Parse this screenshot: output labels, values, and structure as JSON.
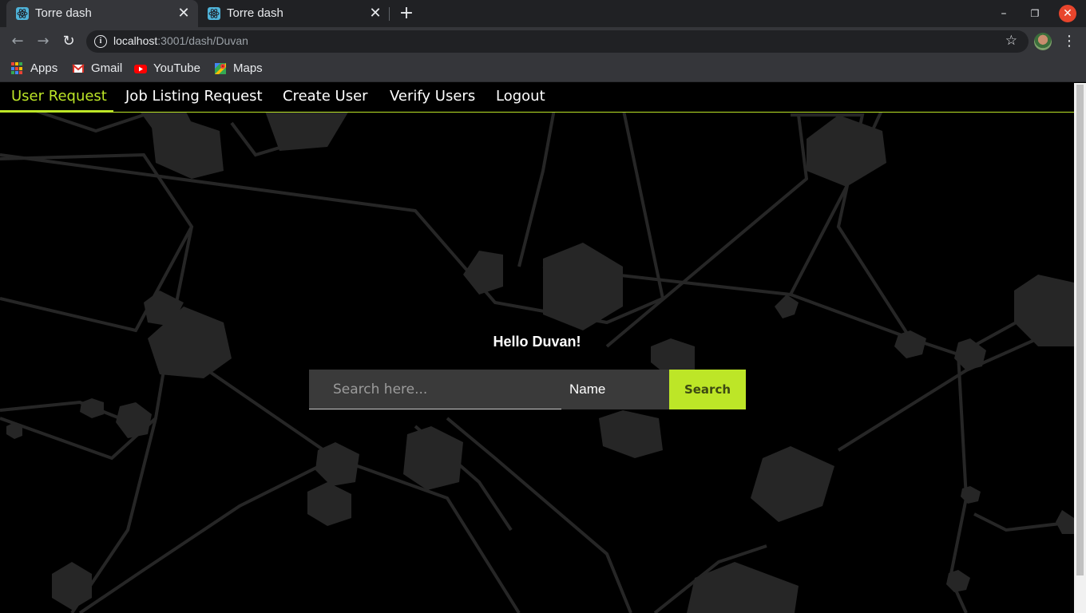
{
  "browser": {
    "tabs": [
      {
        "title": "Torre dash",
        "active": true
      },
      {
        "title": "Torre dash",
        "active": false
      }
    ],
    "address": {
      "host": "localhost",
      "path": ":3001/dash/Duvan"
    },
    "bookmarks": [
      {
        "label": "Apps",
        "icon": "apps-grid-icon"
      },
      {
        "label": "Gmail",
        "icon": "gmail-icon"
      },
      {
        "label": "YouTube",
        "icon": "youtube-icon"
      },
      {
        "label": "Maps",
        "icon": "maps-icon"
      }
    ]
  },
  "nav": {
    "items": [
      {
        "label": "User Request",
        "active": true
      },
      {
        "label": "Job Listing Request",
        "active": false
      },
      {
        "label": "Create User",
        "active": false
      },
      {
        "label": "Verify Users",
        "active": false
      },
      {
        "label": "Logout",
        "active": false
      }
    ]
  },
  "main": {
    "greeting": "Hello Duvan!",
    "search": {
      "placeholder": "Search here...",
      "value": "",
      "filter_selected": "Name",
      "button_label": "Search"
    }
  },
  "colors": {
    "accent": "#bde627",
    "background": "#000000",
    "input_bg": "#3a3a3a"
  }
}
